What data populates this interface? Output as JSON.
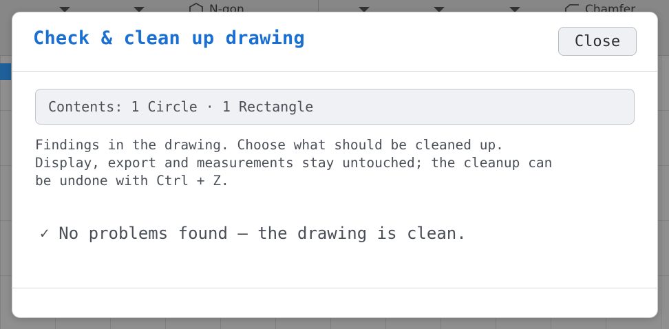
{
  "background_app": {
    "toolbar": {
      "ngon_label": "N-gon",
      "chamfer_label": "Chamfer"
    }
  },
  "dialog": {
    "title": "Check & clean up drawing",
    "close_label": "Close",
    "contents_summary": "Contents: 1 Circle · 1 Rectangle",
    "description_lines": [
      "Findings in the drawing. Choose what should be cleaned up.",
      "Display, export and measurements stay untouched; the cleanup can",
      "be undone with Ctrl + Z."
    ],
    "status_icon": "check-icon",
    "status_check_glyph": "✓",
    "status_text": "No problems found — the drawing is clean."
  },
  "colors": {
    "title": "#1a6fd1",
    "accent_strip": "#1f5f9a"
  }
}
